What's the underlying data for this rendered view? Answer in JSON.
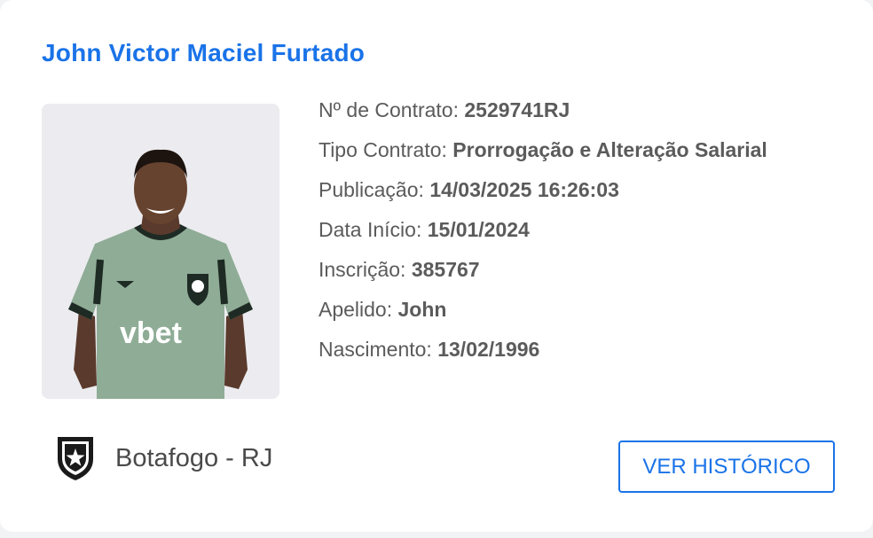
{
  "player": {
    "name": "John Victor Maciel Furtado"
  },
  "details": [
    {
      "label": "Nº de Contrato:",
      "value": "2529741RJ"
    },
    {
      "label": "Tipo Contrato:",
      "value": "Prorrogação e Alteração Salarial"
    },
    {
      "label": "Publicação:",
      "value": "14/03/2025 16:26:03"
    },
    {
      "label": "Data Início:",
      "value": "15/01/2024"
    },
    {
      "label": "Inscrição:",
      "value": "385767"
    },
    {
      "label": "Apelido:",
      "value": "John"
    },
    {
      "label": "Nascimento:",
      "value": "13/02/1996"
    }
  ],
  "jersey": {
    "sponsor": "vbet"
  },
  "club": {
    "name": "Botafogo - RJ",
    "icon": "botafogo-crest-icon"
  },
  "actions": {
    "history_label": "VER HISTÓRICO"
  },
  "colors": {
    "accent": "#1a73e8",
    "text": "#5b5b5b",
    "jersey": "#8fac96"
  }
}
